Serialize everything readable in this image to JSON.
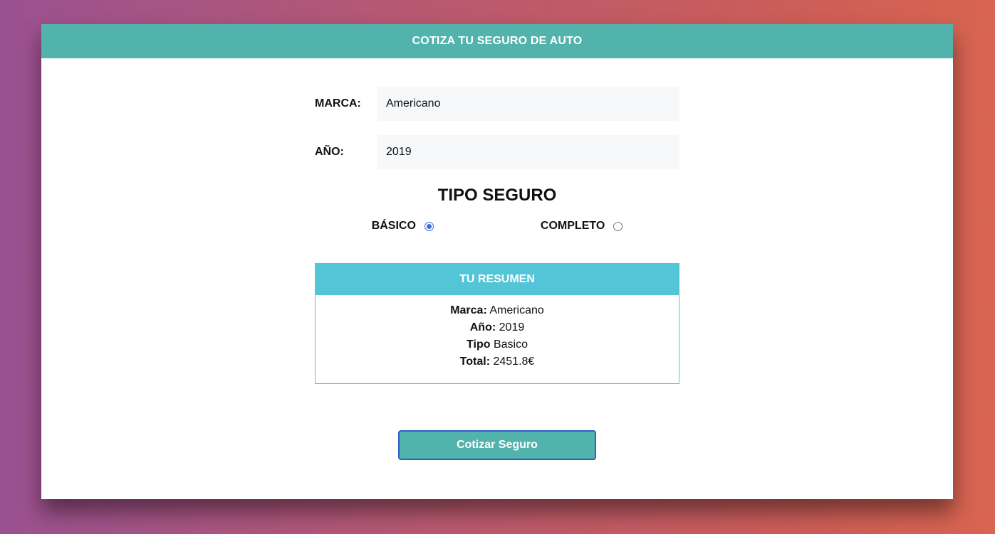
{
  "header": {
    "title": "COTIZA TU SEGURO DE AUTO"
  },
  "form": {
    "marca_label": "MARCA:",
    "marca_value": "Americano",
    "anio_label": "AÑO:",
    "anio_value": "2019",
    "tipo_title": "TIPO SEGURO",
    "radios": [
      {
        "label": "BÁSICO",
        "checked": true
      },
      {
        "label": "COMPLETO",
        "checked": false
      }
    ]
  },
  "resumen": {
    "title": "TU RESUMEN",
    "rows": [
      {
        "key": "Marca:",
        "value": "Americano"
      },
      {
        "key": "Año:",
        "value": "2019"
      },
      {
        "key": "Tipo",
        "value": "Basico"
      },
      {
        "key": "Total:",
        "value": "2451.8€"
      }
    ]
  },
  "button": {
    "label": "Cotizar Seguro"
  },
  "colors": {
    "header_bg": "#52b3ac",
    "resumen_bg": "#52c5d7",
    "button_border": "#2f5fc4"
  }
}
